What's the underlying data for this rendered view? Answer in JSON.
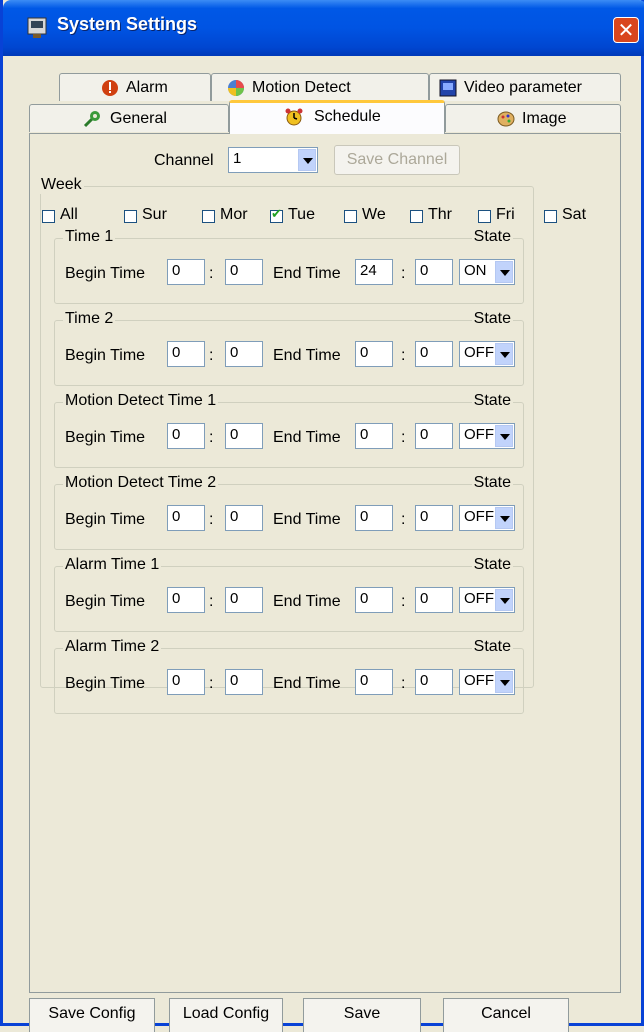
{
  "window": {
    "title": "System Settings"
  },
  "tabs_row1": [
    {
      "label": "Alarm",
      "icon": "alarm-icon"
    },
    {
      "label": "Motion Detect",
      "icon": "motion-detect-icon"
    },
    {
      "label": "Video parameter",
      "icon": "video-parameter-icon"
    }
  ],
  "tabs_row2": [
    {
      "label": "General",
      "icon": "general-icon"
    },
    {
      "label": "Schedule",
      "icon": "schedule-icon",
      "active": true
    },
    {
      "label": "Image",
      "icon": "image-icon"
    }
  ],
  "channel": {
    "label": "Channel",
    "value": "1",
    "save_label": "Save Channel"
  },
  "week": {
    "title": "Week",
    "days": [
      {
        "label": "All",
        "checked": false
      },
      {
        "label": "Sur",
        "checked": false
      },
      {
        "label": "Mor",
        "checked": false
      },
      {
        "label": "Tue",
        "checked": true
      },
      {
        "label": "We",
        "checked": false
      },
      {
        "label": "Thr",
        "checked": false
      },
      {
        "label": "Fri",
        "checked": false
      },
      {
        "label": "Sat",
        "checked": false
      }
    ]
  },
  "common": {
    "begin_label": "Begin Time",
    "end_label": "End Time",
    "colon": ":",
    "state_label": "State"
  },
  "time_groups": [
    {
      "title": "Time 1",
      "begin_h": "0",
      "begin_m": "0",
      "end_h": "24",
      "end_m": "0",
      "state": "ON"
    },
    {
      "title": "Time 2",
      "begin_h": "0",
      "begin_m": "0",
      "end_h": "0",
      "end_m": "0",
      "state": "OFF"
    },
    {
      "title": "Motion Detect Time 1",
      "begin_h": "0",
      "begin_m": "0",
      "end_h": "0",
      "end_m": "0",
      "state": "OFF"
    },
    {
      "title": "Motion Detect Time 2",
      "begin_h": "0",
      "begin_m": "0",
      "end_h": "0",
      "end_m": "0",
      "state": "OFF"
    },
    {
      "title": "Alarm Time 1",
      "begin_h": "0",
      "begin_m": "0",
      "end_h": "0",
      "end_m": "0",
      "state": "OFF"
    },
    {
      "title": "Alarm Time 2",
      "begin_h": "0",
      "begin_m": "0",
      "end_h": "0",
      "end_m": "0",
      "state": "OFF"
    }
  ],
  "footer": {
    "save_config": "Save Config",
    "load_config": "Load Config",
    "save": "Save",
    "cancel": "Cancel"
  },
  "colors": {
    "titlebar": "#0054e3",
    "close": "#d9461e",
    "face": "#ece9d8"
  }
}
